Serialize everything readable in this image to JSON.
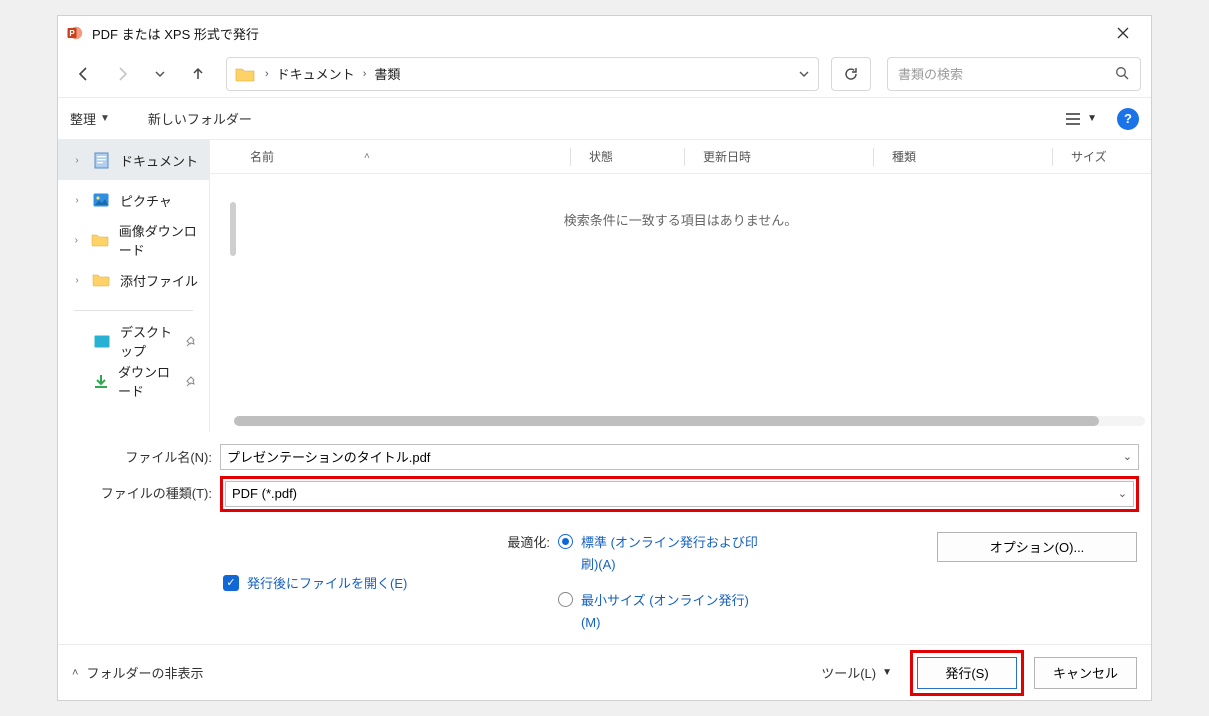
{
  "titlebar": {
    "title": "PDF または XPS 形式で発行"
  },
  "nav": {
    "breadcrumb_label1": "ドキュメント",
    "breadcrumb_label2": "書類"
  },
  "search": {
    "placeholder": "書類の検索"
  },
  "toolbar": {
    "organize": "整理",
    "new_folder": "新しいフォルダー"
  },
  "sidebar": {
    "items": [
      {
        "label": "ドキュメント"
      },
      {
        "label": "ピクチャ"
      },
      {
        "label": "画像ダウンロード"
      },
      {
        "label": "添付ファイル"
      },
      {
        "label": "デスクトップ"
      },
      {
        "label": "ダウンロード"
      }
    ]
  },
  "columns": {
    "name": "名前",
    "status": "状態",
    "date": "更新日時",
    "type": "種類",
    "size": "サイズ"
  },
  "empty_message": "検索条件に一致する項目はありません。",
  "file_name": {
    "label": "ファイル名(N):",
    "value": "プレゼンテーションのタイトル.pdf"
  },
  "file_type": {
    "label": "ファイルの種類(T):",
    "value": "PDF (*.pdf)"
  },
  "open_after": {
    "label": "発行後にファイルを開く(E)"
  },
  "optimize": {
    "label": "最適化:",
    "standard": "標準 (オンライン発行および印刷)(A)",
    "minimum": "最小サイズ (オンライン発行)(M)"
  },
  "options_button": "オプション(O)...",
  "footer": {
    "hide_folders": "フォルダーの非表示",
    "tools": "ツール(L)",
    "publish": "発行(S)",
    "cancel": "キャンセル"
  }
}
